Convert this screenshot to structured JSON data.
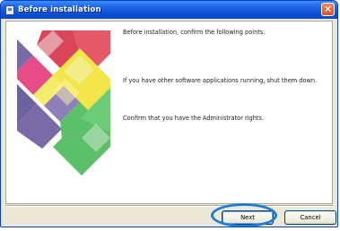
{
  "window": {
    "title": "Before installation"
  },
  "content": {
    "intro": "Before installation, confirm the following points.",
    "point_1": "If you have other software applications running, shut them down.",
    "point_2": "Confirm that you have the Administrator rights."
  },
  "buttons": {
    "next_label": "Next",
    "cancel_label": "Cancel"
  },
  "colors": {
    "titlebar": "#0d4fd8",
    "highlight_ring": "#1a7fcf",
    "art_red": "#d9465a",
    "art_yellow": "#f2e64a",
    "art_purple": "#7b6aa8",
    "art_green": "#5cbf6a",
    "art_pink": "#e84c86"
  }
}
